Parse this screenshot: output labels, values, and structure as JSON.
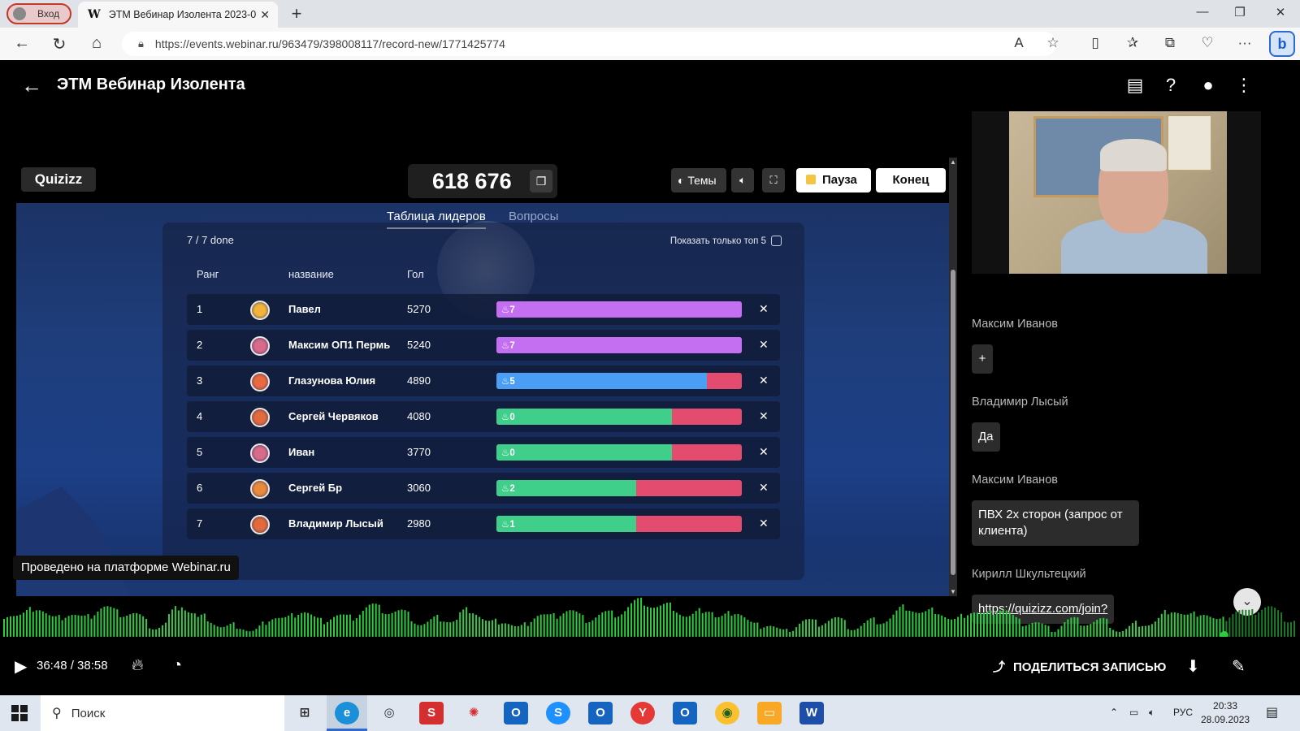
{
  "browser": {
    "profile_label": "Вход",
    "tab_title": "ЭТМ Вебинар Изолента 2023-0",
    "tab_logo": "W",
    "url": "https://events.webinar.ru/963479/398008117/record-new/1771425774",
    "icons": [
      "back-icon",
      "refresh-icon",
      "home-icon",
      "lock-icon",
      "read-aloud-icon",
      "favorite-icon",
      "split-screen-icon",
      "favorites-icon",
      "collections-icon",
      "heart-icon",
      "more-icon",
      "bing-icon"
    ]
  },
  "webinar": {
    "title": "ЭТМ Вебинар Изолента",
    "platform_badge": "Проведено на платформе Webinar.ru"
  },
  "quiz": {
    "logo": "Quizizz",
    "code": "618 676",
    "themes_label": "Темы",
    "pause_label": "Пауза",
    "end_label": "Конец",
    "tabs": [
      {
        "label": "Таблица лидеров",
        "active": true
      },
      {
        "label": "Вопросы",
        "active": false
      }
    ],
    "done_label": "7 / 7 done",
    "top5_label": "Показать только топ 5",
    "columns": {
      "rank": "Ранг",
      "name": "название",
      "score": "Гол"
    },
    "rows": [
      {
        "rank": "1",
        "name": "Павел",
        "score": "5270",
        "streak": "7",
        "correct_frac": 1.0,
        "fill": "#c46ff2",
        "avatar": "#f2b53a"
      },
      {
        "rank": "2",
        "name": "Максим ОП1 Пермь",
        "score": "5240",
        "streak": "7",
        "correct_frac": 1.0,
        "fill": "#c46ff2",
        "avatar": "#d86a8a"
      },
      {
        "rank": "3",
        "name": "Глазунова Юлия",
        "score": "4890",
        "streak": "5",
        "correct_frac": 0.857,
        "fill": "#4a9ff5",
        "avatar": "#e86a3e"
      },
      {
        "rank": "4",
        "name": "Сергей Червяков",
        "score": "4080",
        "streak": "0",
        "correct_frac": 0.714,
        "fill": "#3fcf8a",
        "avatar": "#e36a3a"
      },
      {
        "rank": "5",
        "name": "Иван",
        "score": "3770",
        "streak": "0",
        "correct_frac": 0.714,
        "fill": "#3fcf8a",
        "avatar": "#d86a8a"
      },
      {
        "rank": "6",
        "name": "Сергей Бр",
        "score": "3060",
        "streak": "2",
        "correct_frac": 0.571,
        "fill": "#3fcf8a",
        "avatar": "#e88a3a"
      },
      {
        "rank": "7",
        "name": "Владимир Лысый",
        "score": "2980",
        "streak": "1",
        "correct_frac": 0.571,
        "fill": "#3fcf8a",
        "avatar": "#e36a3a"
      }
    ]
  },
  "chat": {
    "messages": [
      {
        "author": "Максим Иванов",
        "text": "+"
      },
      {
        "author": "Владимир Лысый",
        "text": "Да"
      },
      {
        "author": "Максим Иванов",
        "text": "ПВХ 2х сторон (запрос от клиента)"
      },
      {
        "author": "Кирилл Шкультецкий",
        "text": "https://quizizz.com/join?"
      }
    ]
  },
  "player": {
    "time": "36:48 / 38:58",
    "share_label": "ПОДЕЛИТЬСЯ ЗАПИСЬЮ",
    "progress_frac": 0.944
  },
  "taskbar": {
    "search_placeholder": "Поиск",
    "lang": "РУС",
    "time": "20:33",
    "date": "28.09.2023"
  },
  "colors": {
    "accent_green": "#3fcf8a",
    "wrong_red": "#e34c6e",
    "wave_green": "#2ecc40"
  }
}
